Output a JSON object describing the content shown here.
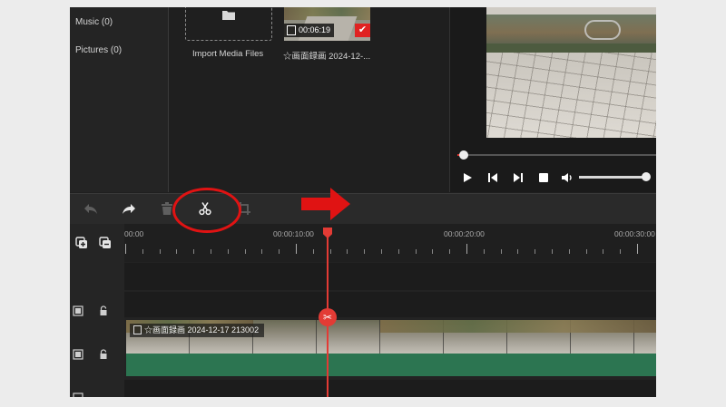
{
  "sidebar": {
    "items": [
      {
        "label": "Music (0)"
      },
      {
        "label": "Pictures (0)"
      }
    ]
  },
  "media": {
    "import_label": "Import Media Files",
    "clip_name": "☆画面録画 2024-12-...",
    "clip_duration": "00:06:19"
  },
  "preview": {
    "playback_progress": 0.03,
    "volume_level": 0.92
  },
  "toolbar": {
    "tools": [
      "undo-icon",
      "redo-icon",
      "delete-icon",
      "split-icon",
      "crop-icon"
    ]
  },
  "timeline": {
    "timestamps": [
      "00:00",
      "00:00:10:00",
      "00:00:20:00",
      "00:00:30:00"
    ],
    "clip_label": "☆画面録画 2024-12-17 213002"
  },
  "colors": {
    "accent": "#e33b35",
    "audio_track": "#2c7551",
    "annotation": "#e01313"
  }
}
